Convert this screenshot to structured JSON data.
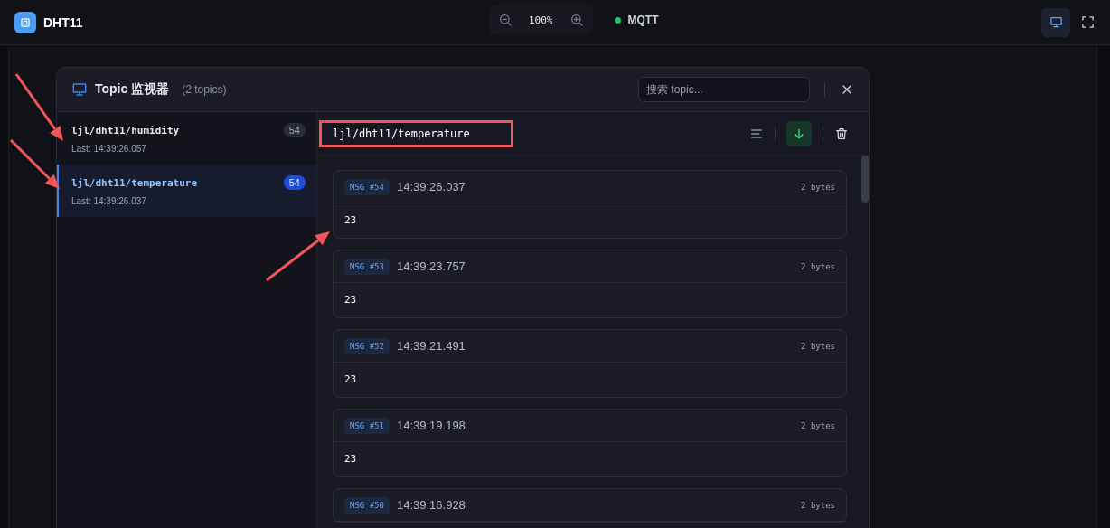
{
  "app": {
    "title": "DHT11"
  },
  "toolbar": {
    "zoom": "100%",
    "connection": {
      "label": "MQTT",
      "connected": true
    }
  },
  "monitor": {
    "title": "Topic 监视器",
    "count": "(2 topics)",
    "search": {
      "placeholder": "搜索 topic..."
    },
    "topics": [
      {
        "name": "ljl/dht11/humidity",
        "last": "Last: 14:39:26.057",
        "count": "54",
        "selected": false
      },
      {
        "name": "ljl/dht11/temperature",
        "last": "Last: 14:39:26.037",
        "count": "54",
        "selected": true
      }
    ],
    "current_topic": "ljl/dht11/temperature",
    "autoscroll": true,
    "messages": [
      {
        "id": "MSG #54",
        "time": "14:39:26.037",
        "size": "2 bytes",
        "value": "23"
      },
      {
        "id": "MSG #53",
        "time": "14:39:23.757",
        "size": "2 bytes",
        "value": "23"
      },
      {
        "id": "MSG #52",
        "time": "14:39:21.491",
        "size": "2 bytes",
        "value": "23"
      },
      {
        "id": "MSG #51",
        "time": "14:39:19.198",
        "size": "2 bytes",
        "value": "23"
      },
      {
        "id": "MSG #50",
        "time": "14:39:16.928",
        "size": "2 bytes"
      }
    ]
  }
}
